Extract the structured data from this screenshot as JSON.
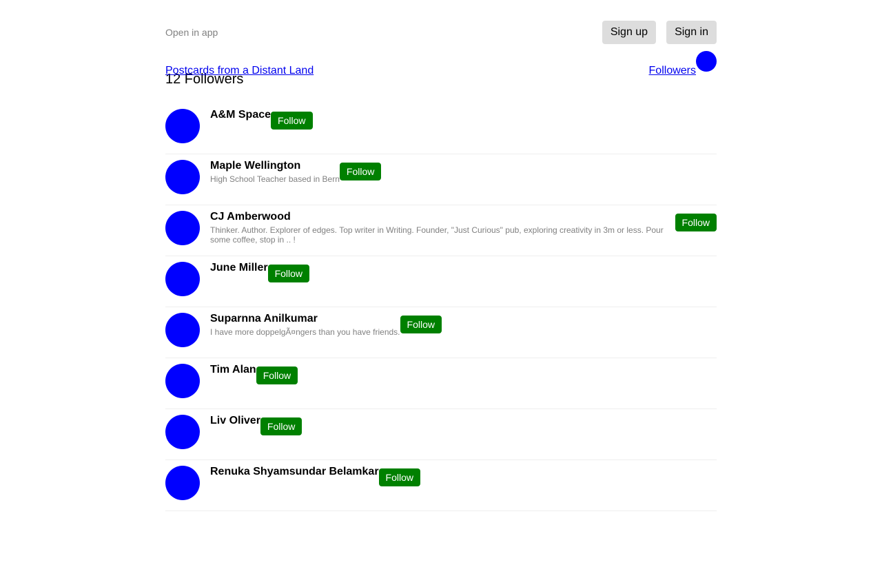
{
  "topbar": {
    "open_in_app": "Open in app",
    "sign_up": "Sign up",
    "sign_in": "Sign in"
  },
  "publication": {
    "title": "Postcards from a Distant Land",
    "followers_link": "Followers",
    "count_label": "12 Followers"
  },
  "colors": {
    "avatar": "#0000ff",
    "follow_button": "#008000",
    "auth_button": "#dddddd",
    "link": "#0000ee"
  },
  "followers": [
    {
      "name": "A&M Space",
      "bio": "",
      "button": "Follow"
    },
    {
      "name": "Maple Wellington",
      "bio": "High School Teacher based in Bern",
      "button": "Follow"
    },
    {
      "name": "CJ Amberwood",
      "bio": "Thinker. Author. Explorer of edges. Top writer in Writing. Founder, \"Just Curious\" pub, exploring creativity in 3m or less. Pour some coffee, stop in .. !",
      "button": "Follow"
    },
    {
      "name": "June Miller",
      "bio": "",
      "button": "Follow"
    },
    {
      "name": "Suparnna Anilkumar",
      "bio": "I have more doppelgÃ¤ngers than you have friends.",
      "button": "Follow"
    },
    {
      "name": "Tim Alan",
      "bio": "",
      "button": "Follow"
    },
    {
      "name": "Liv Oliver",
      "bio": "",
      "button": "Follow"
    },
    {
      "name": "Renuka Shyamsundar Belamkar",
      "bio": "",
      "button": "Follow"
    }
  ]
}
